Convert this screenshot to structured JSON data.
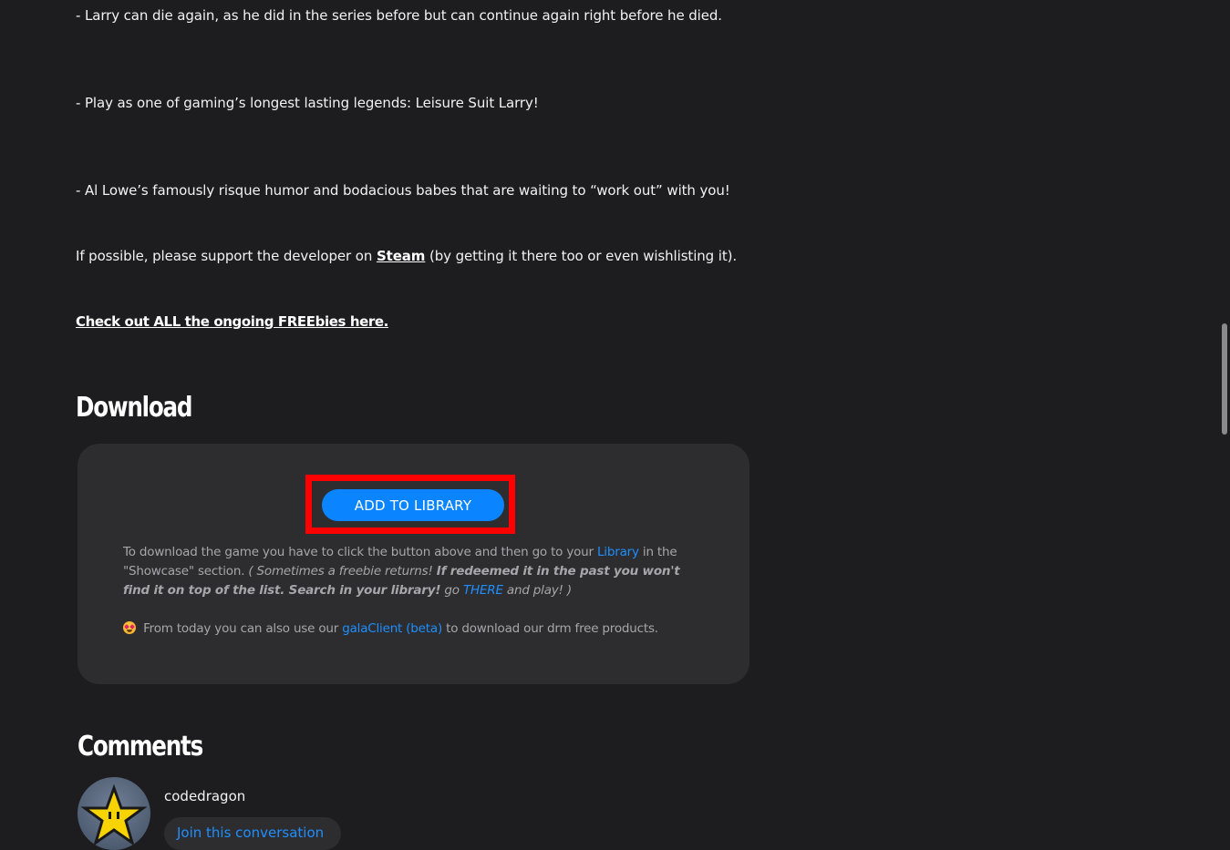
{
  "description_lines": [
    "- Larry can die again, as he did in the series before but can continue again right before he died.",
    "- Play as one of gaming’s longest lasting legends: Leisure Suit Larry!",
    "- Al Lowe’s famously risque humor and bodacious babes that are waiting to “work out” with you!"
  ],
  "support": {
    "prefix": "If possible, please support the developer on ",
    "link": "Steam",
    "suffix": " (by getting it there too or even wishlisting it)."
  },
  "freebies_link": "Check out ALL the ongoing FREEbies here.",
  "download": {
    "heading": "Download",
    "button_label": "ADD TO LIBRARY",
    "info": {
      "part1": "To download the game you have to click the button above and then go to your ",
      "library_link": "Library",
      "part2": " in the \"Showcase\" section. ",
      "italic1": "( Sometimes a freebie returns! ",
      "bold_italic": "If redeemed it in the past you won't find it on top of the list. Search in your library!",
      "italic2": " go ",
      "there_link": "THERE",
      "italic3": " and play! )"
    },
    "client": {
      "emoji": "star-struck",
      "prefix": " From today you can also use our ",
      "link": "galaClient (beta)",
      "suffix": " to download our drm free products."
    }
  },
  "comments": {
    "heading": "Comments",
    "username": "codedragon",
    "join_label": "Join this conversation"
  },
  "colors": {
    "background": "#1d1d1f",
    "panel": "#2d2d30",
    "accent": "#0a84ff",
    "link": "#1f8fff",
    "highlight": "#ff0000"
  }
}
